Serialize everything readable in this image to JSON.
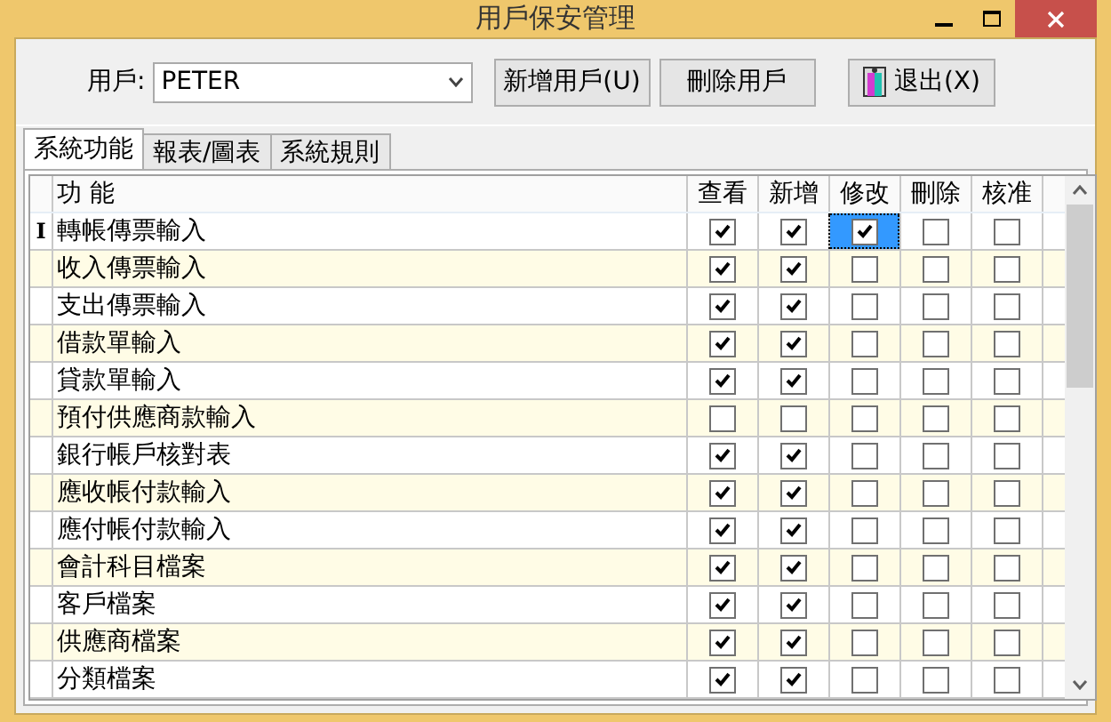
{
  "window": {
    "title": "用戶保安管理"
  },
  "user_field": {
    "label": "用戶:",
    "value": "PETER"
  },
  "buttons": [
    {
      "kind": "plain",
      "label": "新增用戶(U)"
    },
    {
      "kind": "plain",
      "label": "刪除用戶"
    },
    {
      "kind": "exit",
      "label": "退出(X)"
    }
  ],
  "tabs": [
    {
      "label": "系統功能",
      "selected": true
    },
    {
      "label": "報表/圖表",
      "selected": false
    },
    {
      "label": "系統規則",
      "selected": false
    }
  ],
  "table": {
    "row_marker": "I",
    "columns": [
      "功 能",
      "查看",
      "新增",
      "修改",
      "刪除",
      "核准"
    ],
    "rows": [
      {
        "name": "轉帳傳票輸入",
        "selected": true,
        "perms": [
          {
            "checked": true,
            "focused": false
          },
          {
            "checked": true,
            "focused": false
          },
          {
            "checked": true,
            "focused": true
          },
          {
            "checked": false,
            "focused": false
          },
          {
            "checked": false,
            "focused": false
          }
        ]
      },
      {
        "name": "收入傳票輸入",
        "selected": false,
        "perms": [
          {
            "checked": true,
            "focused": false
          },
          {
            "checked": true,
            "focused": false
          },
          {
            "checked": false,
            "focused": false
          },
          {
            "checked": false,
            "focused": false
          },
          {
            "checked": false,
            "focused": false
          }
        ]
      },
      {
        "name": "支出傳票輸入",
        "selected": false,
        "perms": [
          {
            "checked": true,
            "focused": false
          },
          {
            "checked": true,
            "focused": false
          },
          {
            "checked": false,
            "focused": false
          },
          {
            "checked": false,
            "focused": false
          },
          {
            "checked": false,
            "focused": false
          }
        ]
      },
      {
        "name": "借款單輸入",
        "selected": false,
        "perms": [
          {
            "checked": true,
            "focused": false
          },
          {
            "checked": true,
            "focused": false
          },
          {
            "checked": false,
            "focused": false
          },
          {
            "checked": false,
            "focused": false
          },
          {
            "checked": false,
            "focused": false
          }
        ]
      },
      {
        "name": "貸款單輸入",
        "selected": false,
        "perms": [
          {
            "checked": true,
            "focused": false
          },
          {
            "checked": true,
            "focused": false
          },
          {
            "checked": false,
            "focused": false
          },
          {
            "checked": false,
            "focused": false
          },
          {
            "checked": false,
            "focused": false
          }
        ]
      },
      {
        "name": "預付供應商款輸入",
        "selected": false,
        "perms": [
          {
            "checked": false,
            "focused": false
          },
          {
            "checked": false,
            "focused": false
          },
          {
            "checked": false,
            "focused": false
          },
          {
            "checked": false,
            "focused": false
          },
          {
            "checked": false,
            "focused": false
          }
        ]
      },
      {
        "name": "銀行帳戶核對表",
        "selected": false,
        "perms": [
          {
            "checked": true,
            "focused": false
          },
          {
            "checked": true,
            "focused": false
          },
          {
            "checked": false,
            "focused": false
          },
          {
            "checked": false,
            "focused": false
          },
          {
            "checked": false,
            "focused": false
          }
        ]
      },
      {
        "name": "應收帳付款輸入",
        "selected": false,
        "perms": [
          {
            "checked": true,
            "focused": false
          },
          {
            "checked": true,
            "focused": false
          },
          {
            "checked": false,
            "focused": false
          },
          {
            "checked": false,
            "focused": false
          },
          {
            "checked": false,
            "focused": false
          }
        ]
      },
      {
        "name": "應付帳付款輸入",
        "selected": false,
        "perms": [
          {
            "checked": true,
            "focused": false
          },
          {
            "checked": true,
            "focused": false
          },
          {
            "checked": false,
            "focused": false
          },
          {
            "checked": false,
            "focused": false
          },
          {
            "checked": false,
            "focused": false
          }
        ]
      },
      {
        "name": "會計科目檔案",
        "selected": false,
        "perms": [
          {
            "checked": true,
            "focused": false
          },
          {
            "checked": true,
            "focused": false
          },
          {
            "checked": false,
            "focused": false
          },
          {
            "checked": false,
            "focused": false
          },
          {
            "checked": false,
            "focused": false
          }
        ]
      },
      {
        "name": "客戶檔案",
        "selected": false,
        "perms": [
          {
            "checked": true,
            "focused": false
          },
          {
            "checked": true,
            "focused": false
          },
          {
            "checked": false,
            "focused": false
          },
          {
            "checked": false,
            "focused": false
          },
          {
            "checked": false,
            "focused": false
          }
        ]
      },
      {
        "name": "供應商檔案",
        "selected": false,
        "perms": [
          {
            "checked": true,
            "focused": false
          },
          {
            "checked": true,
            "focused": false
          },
          {
            "checked": false,
            "focused": false
          },
          {
            "checked": false,
            "focused": false
          },
          {
            "checked": false,
            "focused": false
          }
        ]
      },
      {
        "name": "分類檔案",
        "selected": false,
        "perms": [
          {
            "checked": true,
            "focused": false
          },
          {
            "checked": true,
            "focused": false
          },
          {
            "checked": false,
            "focused": false
          },
          {
            "checked": false,
            "focused": false
          },
          {
            "checked": false,
            "focused": false
          }
        ]
      }
    ]
  }
}
